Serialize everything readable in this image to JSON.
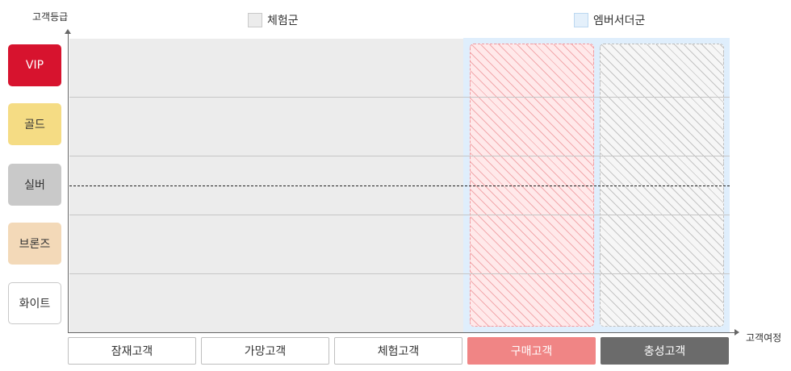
{
  "axes": {
    "y_label": "고객등급",
    "x_label": "고객여정"
  },
  "legend": [
    {
      "label": "체험군",
      "color": "#ececec"
    },
    {
      "label": "엠버서더군",
      "color": "#e4f0fb"
    }
  ],
  "tiers": [
    {
      "label": "VIP",
      "color": "#d7132e"
    },
    {
      "label": "골드",
      "color": "#f5dc84"
    },
    {
      "label": "실버",
      "color": "#c9c9c9"
    },
    {
      "label": "브론즈",
      "color": "#f3d9b8"
    },
    {
      "label": "화이트",
      "color": "#ffffff"
    }
  ],
  "stages": [
    {
      "label": "잠재고객"
    },
    {
      "label": "가망고객"
    },
    {
      "label": "체험고객"
    },
    {
      "label": "구매고객",
      "color": "#f08585"
    },
    {
      "label": "충성고객",
      "color": "#6b6b6b"
    }
  ]
}
